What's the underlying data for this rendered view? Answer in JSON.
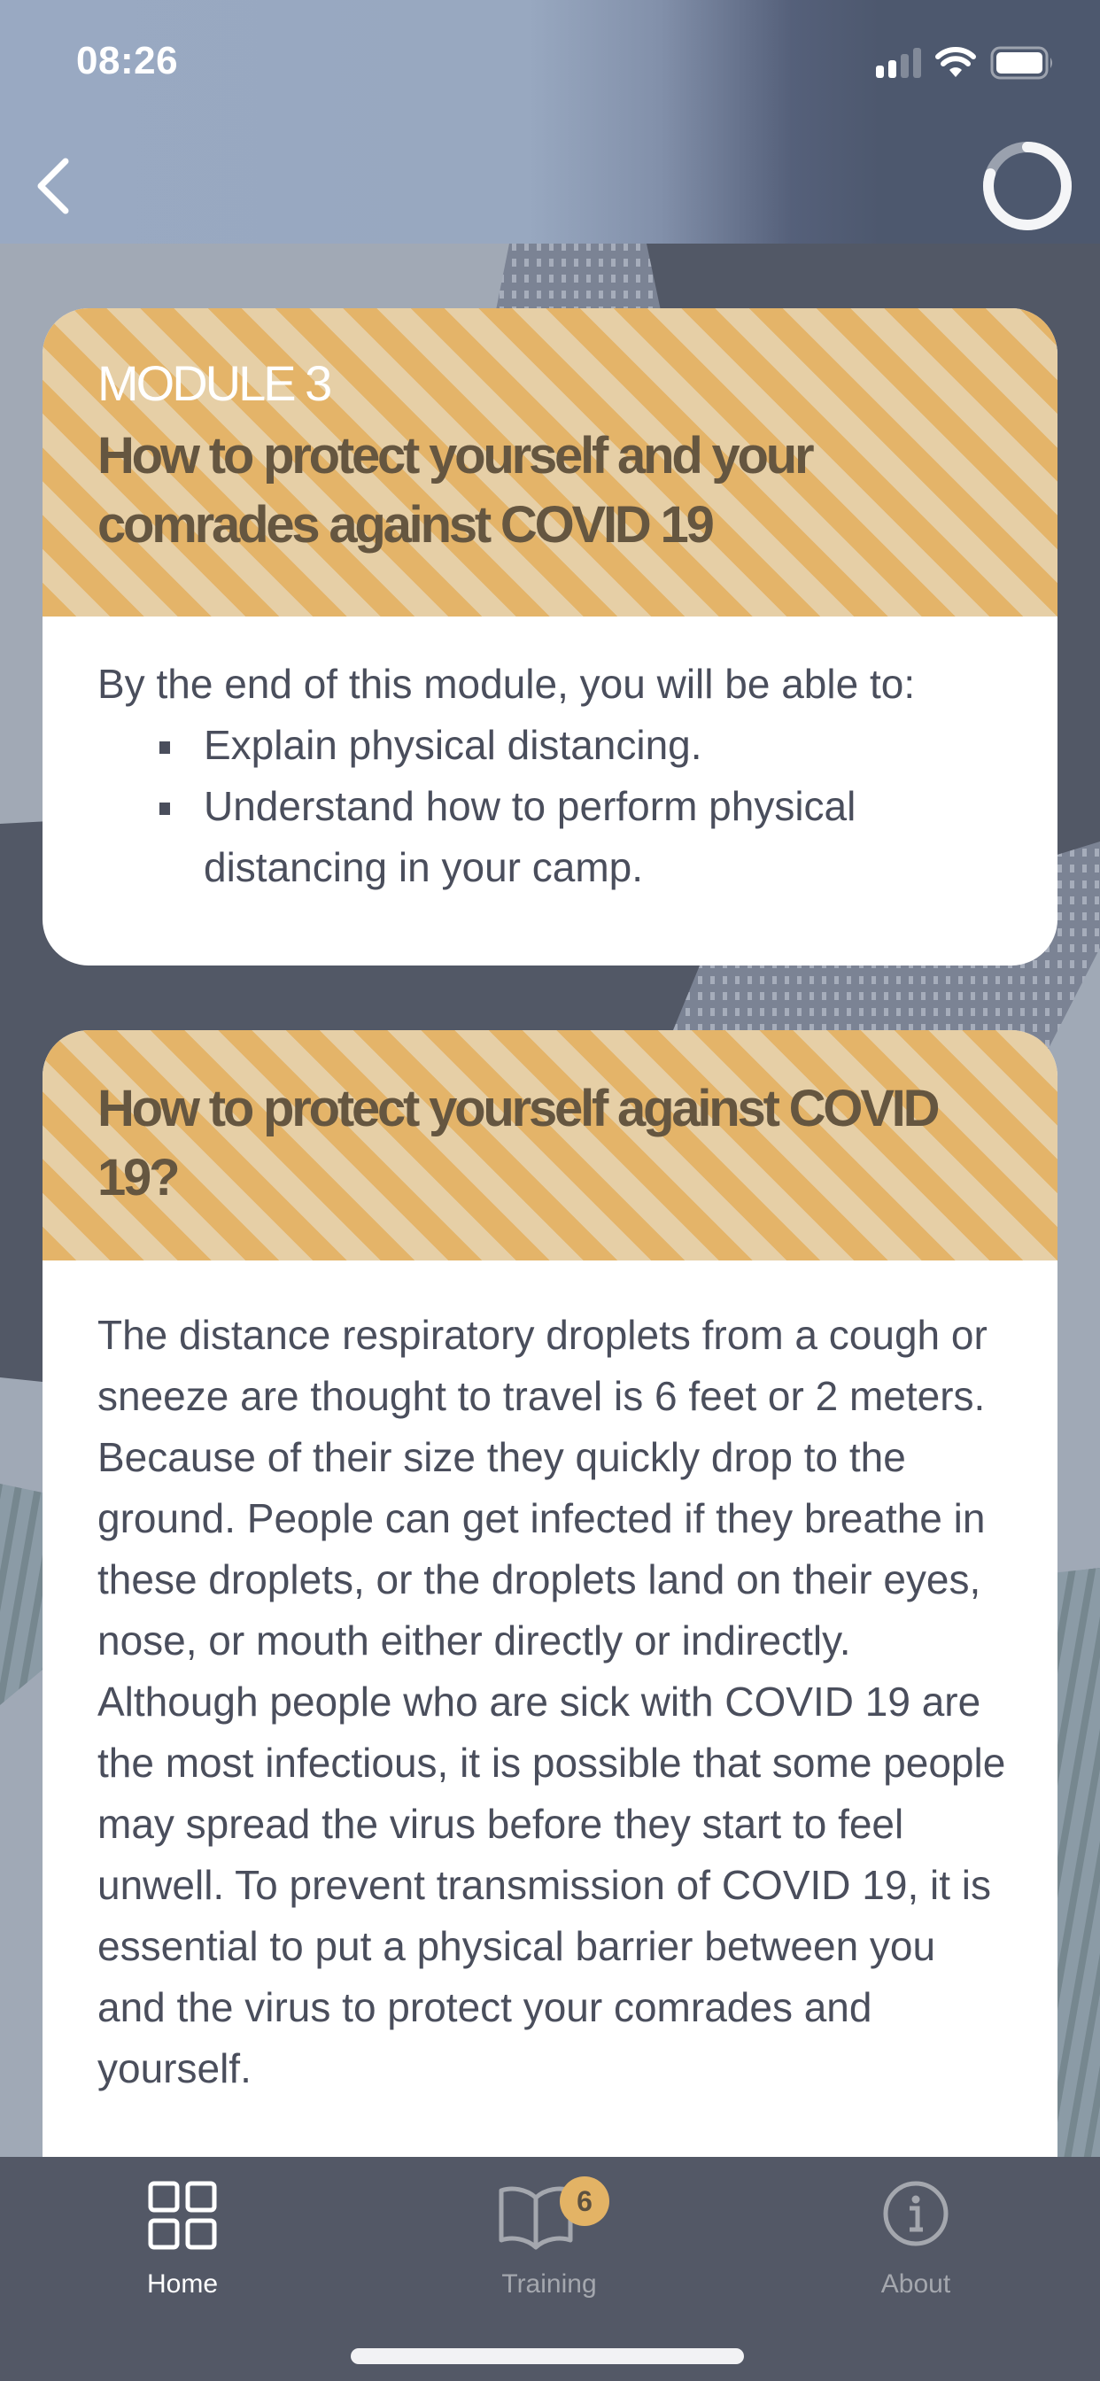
{
  "status_bar": {
    "time": "08:26",
    "signal_bars_active": 2,
    "signal_bars_total": 4,
    "wifi": "wifi-icon",
    "battery": "battery-full-icon"
  },
  "nav": {
    "back_icon": "chevron-left-icon",
    "progress_percent": 80,
    "progress_icon": "progress-ring-icon"
  },
  "cards": [
    {
      "module_label": "MODULE 3",
      "title": "How to protect yourself and your comrades against COVID 19",
      "intro": "By the end of this module, you will be able to:",
      "objectives": [
        "Explain physical distancing.",
        "Understand how to perform physical distancing in your camp."
      ]
    },
    {
      "title": "How to protect yourself against COVID 19?",
      "body": "The distance respiratory droplets from a cough or sneeze are thought to travel is 6 feet or 2 meters. Because of their size they quickly drop to the ground. People can get infected if they breathe in these droplets, or the droplets land on their eyes, nose, or mouth either directly or indirectly. Although people who are sick with COVID 19 are the most infectious, it is possible that some people may spread the virus before they start to feel unwell. To prevent transmission of COVID 19, it is essential to put a physical barrier between you and the virus to protect your comrades and yourself."
    }
  ],
  "tabbar": {
    "tabs": [
      {
        "label": "Home",
        "icon": "grid-icon",
        "active": true
      },
      {
        "label": "Training",
        "icon": "book-icon",
        "active": false,
        "badge": "6"
      },
      {
        "label": "About",
        "icon": "info-icon",
        "active": false
      }
    ]
  },
  "colors": {
    "accent": "#E4B469",
    "stripe_light": "#E6CFA6",
    "title_text": "#655640",
    "body_text": "#4A4E5C",
    "tabbar_bg": "#535866"
  }
}
